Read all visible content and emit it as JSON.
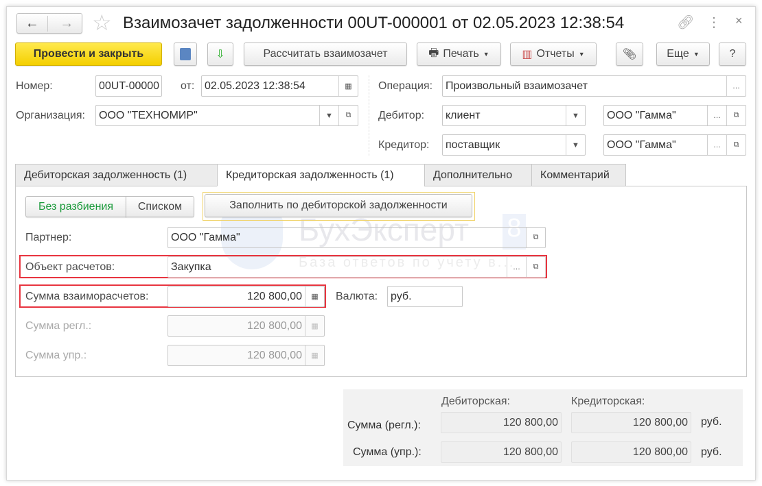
{
  "title": "Взаимозачет задолженности 00UT-000001 от 02.05.2023 12:38:54",
  "toolbar": {
    "post_close": "Провести и закрыть",
    "calculate": "Рассчитать взаимозачет",
    "print": "Печать",
    "reports": "Отчеты",
    "more": "Еще",
    "help": "?"
  },
  "header": {
    "number_label": "Номер:",
    "number_value": "00UT-00000",
    "date_label": "от:",
    "date_value": "02.05.2023 12:38:54",
    "org_label": "Организация:",
    "org_value": "ООО \"ТЕХНОМИР\"",
    "operation_label": "Операция:",
    "operation_value": "Произвольный взаимозачет",
    "debtor_label": "Дебитор:",
    "debtor_type": "клиент",
    "debtor_value": "ООО \"Гамма\"",
    "creditor_label": "Кредитор:",
    "creditor_type": "поставщик",
    "creditor_value": "ООО \"Гамма\""
  },
  "tabs": [
    "Дебиторская задолженность (1)",
    "Кредиторская задолженность (1)",
    "Дополнительно",
    "Комментарий"
  ],
  "panel": {
    "mode_split": "Без разбиения",
    "mode_list": "Списком",
    "fill_button": "Заполнить по дебиторской задолженности",
    "partner_label": "Партнер:",
    "partner_value": "ООО \"Гамма\"",
    "object_label": "Объект расчетов:",
    "object_value": "Закупка",
    "sum_label": "Сумма взаиморасчетов:",
    "sum_value": "120 800,00",
    "currency_label": "Валюта:",
    "currency_value": "руб.",
    "sum_regl_label": "Сумма регл.:",
    "sum_regl_value": "120 800,00",
    "sum_upr_label": "Сумма упр.:",
    "sum_upr_value": "120 800,00"
  },
  "watermark": {
    "brand": "БухЭксперт",
    "badge": "8",
    "tagline": "База ответов по учету в..."
  },
  "totals": {
    "col_debit": "Дебиторская:",
    "col_credit": "Кредиторская:",
    "row_regl": "Сумма (регл.):",
    "row_upr": "Сумма (упр.):",
    "regl_debit": "120 800,00",
    "regl_credit": "120 800,00",
    "upr_debit": "120 800,00",
    "upr_credit": "120 800,00",
    "currency": "руб."
  }
}
